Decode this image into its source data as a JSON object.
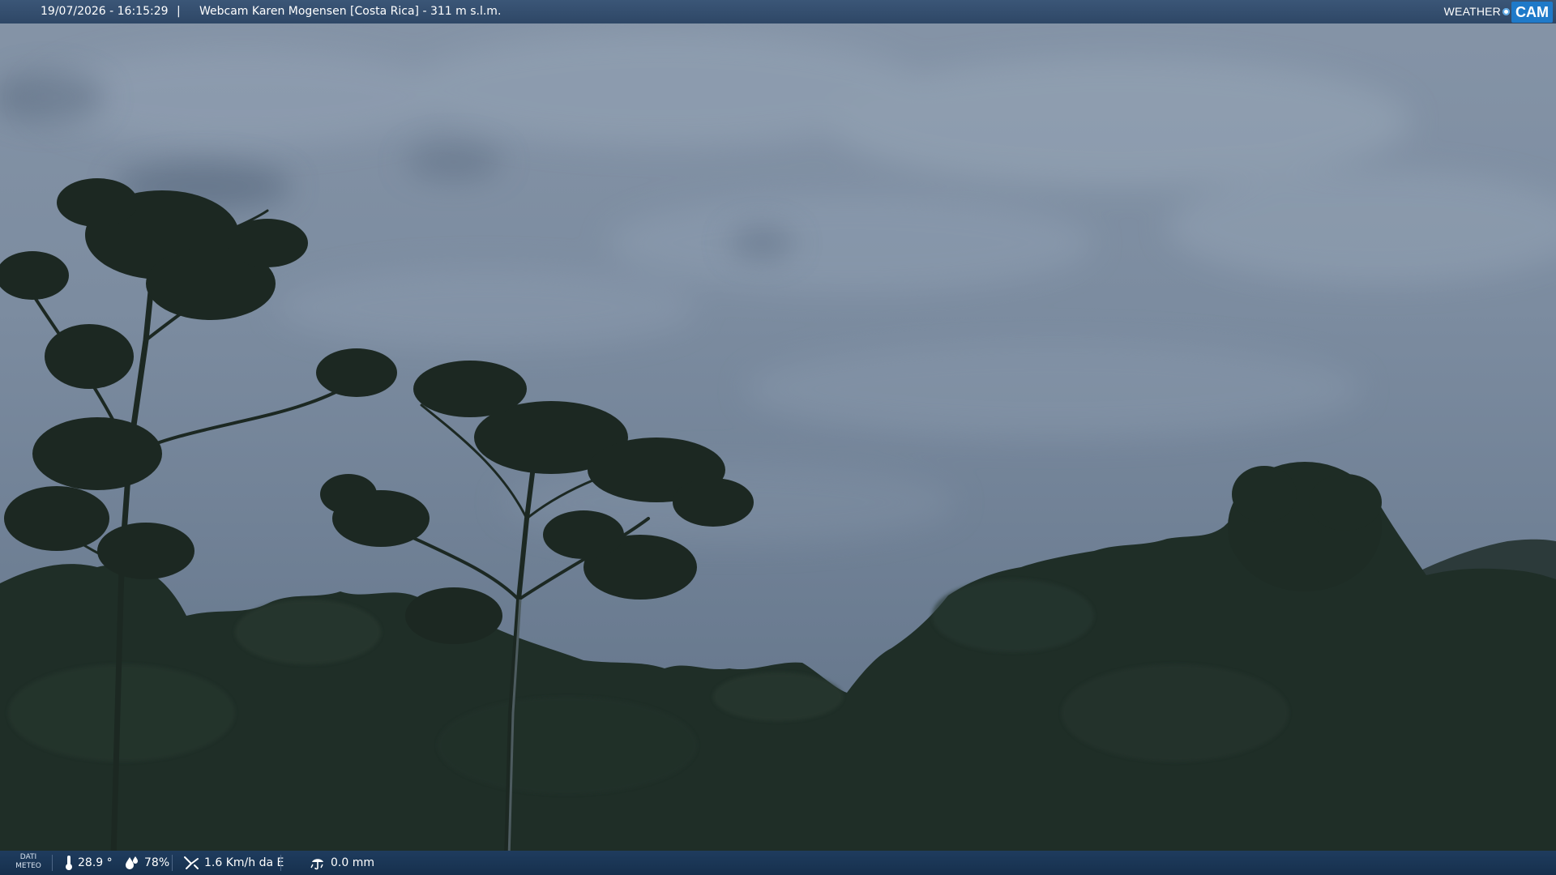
{
  "header": {
    "datetime": "19/07/2026 - 16:15:29",
    "separator": "|",
    "title": "Webcam Karen Mogensen [Costa Rica] - 311 m s.l.m."
  },
  "logo": {
    "word": "WEATHER",
    "cam": "CAM"
  },
  "weather_bar": {
    "label_line1": "DATI",
    "label_line2": "METEO",
    "temperature": "28.9 °",
    "humidity": "78%",
    "wind": "1.6 Km/h da E",
    "rain": "0.0 mm"
  },
  "icons": {
    "temperature": "thermometer-icon",
    "humidity": "humidity-drop-icon",
    "wind": "wind-icon",
    "rain": "rain-gauge-icon"
  },
  "colors": {
    "sky": "#6d7f94",
    "vegetation": "#1f2e27",
    "bar": "#1f3c5e",
    "logo_accent": "#1f7ac9"
  }
}
